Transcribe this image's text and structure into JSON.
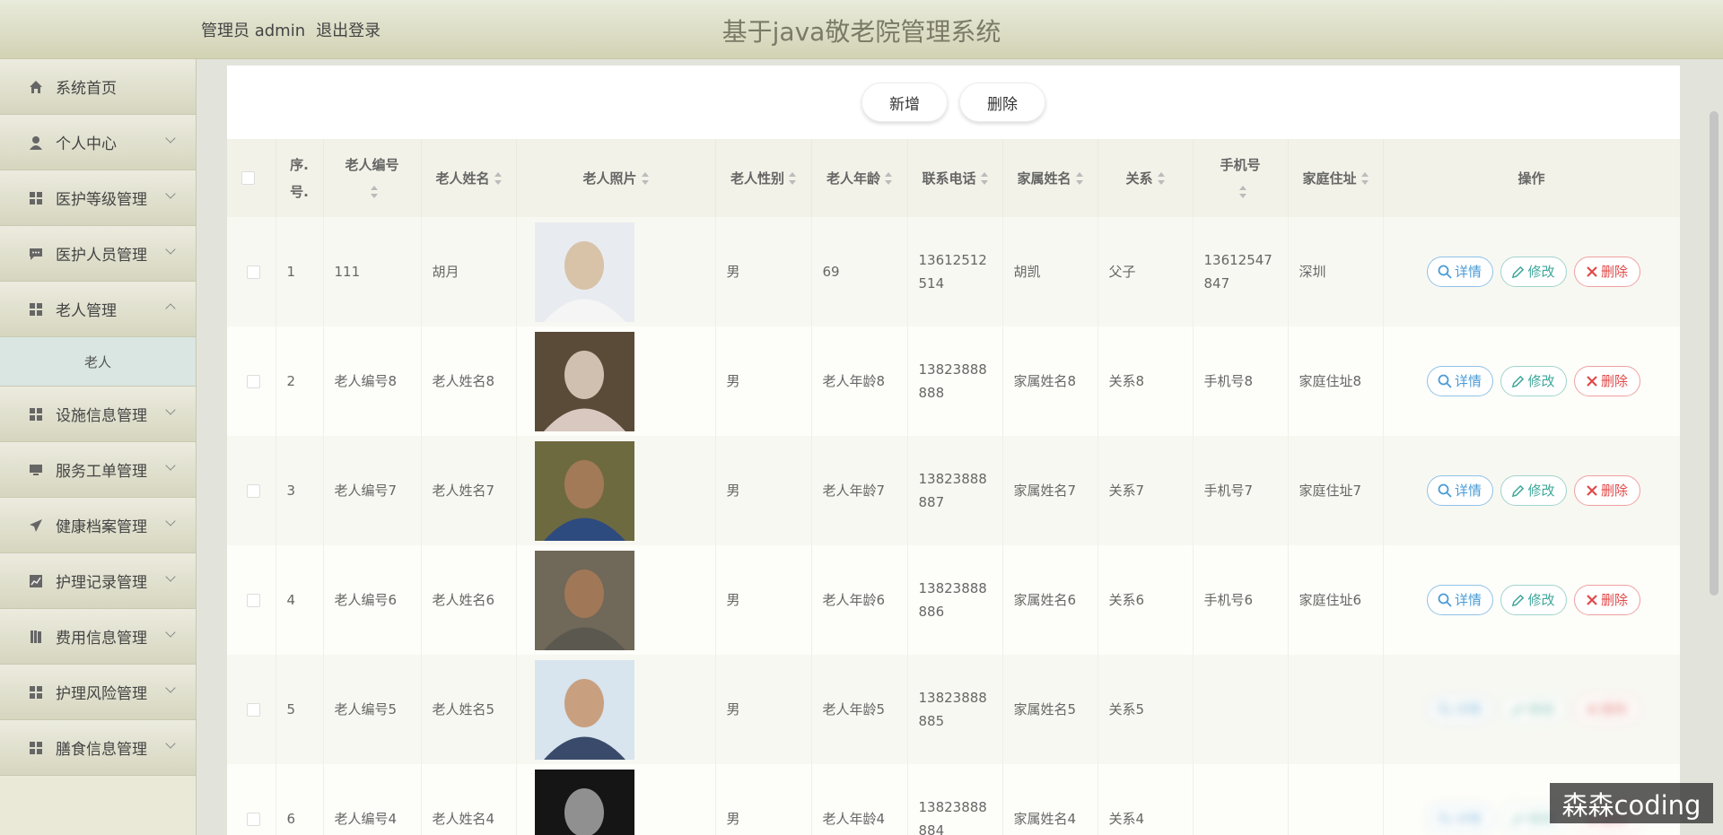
{
  "header": {
    "user": "管理员 admin",
    "logout": "退出登录",
    "title": "基于java敬老院管理系统"
  },
  "sidebar": {
    "items": [
      {
        "label": "系统首页",
        "icon": "home-icon",
        "chevron": "none"
      },
      {
        "label": "个人中心",
        "icon": "user-icon",
        "chevron": "down"
      },
      {
        "label": "医护等级管理",
        "icon": "grid-icon",
        "chevron": "down"
      },
      {
        "label": "医护人员管理",
        "icon": "chat-icon",
        "chevron": "down"
      },
      {
        "label": "老人管理",
        "icon": "grid-icon",
        "chevron": "up"
      },
      {
        "label": "设施信息管理",
        "icon": "grid-icon",
        "chevron": "down"
      },
      {
        "label": "服务工单管理",
        "icon": "monitor-icon",
        "chevron": "down"
      },
      {
        "label": "健康档案管理",
        "icon": "send-icon",
        "chevron": "down"
      },
      {
        "label": "护理记录管理",
        "icon": "chart-icon",
        "chevron": "down"
      },
      {
        "label": "费用信息管理",
        "icon": "book-icon",
        "chevron": "down"
      },
      {
        "label": "护理风险管理",
        "icon": "grid-icon",
        "chevron": "down"
      },
      {
        "label": "膳食信息管理",
        "icon": "grid-icon",
        "chevron": "down"
      }
    ],
    "sub": "老人"
  },
  "toolbar": {
    "add": "新增",
    "delete": "删除"
  },
  "table": {
    "select_all": "",
    "headers": {
      "no": "序.号.",
      "id": "老人编号",
      "name": "老人姓名",
      "photo": "老人照片",
      "gender": "老人性别",
      "age": "老人年龄",
      "phone": "联系电话",
      "family": "家属姓名",
      "relation": "关系",
      "mobile": "手机号",
      "address": "家庭住址",
      "ops": "操作"
    },
    "ops": {
      "detail": "详情",
      "edit": "修改",
      "del": "删除"
    },
    "rows": [
      {
        "no": "1",
        "id": "111",
        "name": "胡月",
        "gender": "男",
        "age": "69",
        "phone": "13612512514",
        "family": "胡凯",
        "relation": "父子",
        "mobile": "13612547847",
        "address": "深圳",
        "photo_colors": [
          "#e8ecf0",
          "#d8c2a8",
          "#f5f5f5"
        ]
      },
      {
        "no": "2",
        "id": "老人编号8",
        "name": "老人姓名8",
        "gender": "男",
        "age": "老人年龄8",
        "phone": "13823888888",
        "family": "家属姓名8",
        "relation": "关系8",
        "mobile": "手机号8",
        "address": "家庭住址8",
        "photo_colors": [
          "#5a4a38",
          "#cfc0b0",
          "#d8c8c0"
        ]
      },
      {
        "no": "3",
        "id": "老人编号7",
        "name": "老人姓名7",
        "gender": "男",
        "age": "老人年龄7",
        "phone": "13823888887",
        "family": "家属姓名7",
        "relation": "关系7",
        "mobile": "手机号7",
        "address": "家庭住址7",
        "photo_colors": [
          "#6e6a40",
          "#a37a58",
          "#2d4b7e"
        ]
      },
      {
        "no": "4",
        "id": "老人编号6",
        "name": "老人姓名6",
        "gender": "男",
        "age": "老人年龄6",
        "phone": "13823888886",
        "family": "家属姓名6",
        "relation": "关系6",
        "mobile": "手机号6",
        "address": "家庭住址6",
        "photo_colors": [
          "#706858",
          "#a07858",
          "#5b5850"
        ]
      },
      {
        "no": "5",
        "id": "老人编号5",
        "name": "老人姓名5",
        "gender": "男",
        "age": "老人年龄5",
        "phone": "13823888885",
        "family": "家属姓名5",
        "relation": "关系5",
        "mobile": "",
        "address": "",
        "photo_colors": [
          "#d8e4ee",
          "#c8a080",
          "#3a4a6a"
        ]
      },
      {
        "no": "6",
        "id": "老人编号4",
        "name": "老人姓名4",
        "gender": "男",
        "age": "老人年龄4",
        "phone": "13823888884",
        "family": "家属姓名4",
        "relation": "关系4",
        "mobile": "",
        "address": "",
        "photo_colors": [
          "#151515",
          "#909090",
          "#2a2a2a"
        ]
      }
    ]
  },
  "watermark": "森森coding"
}
